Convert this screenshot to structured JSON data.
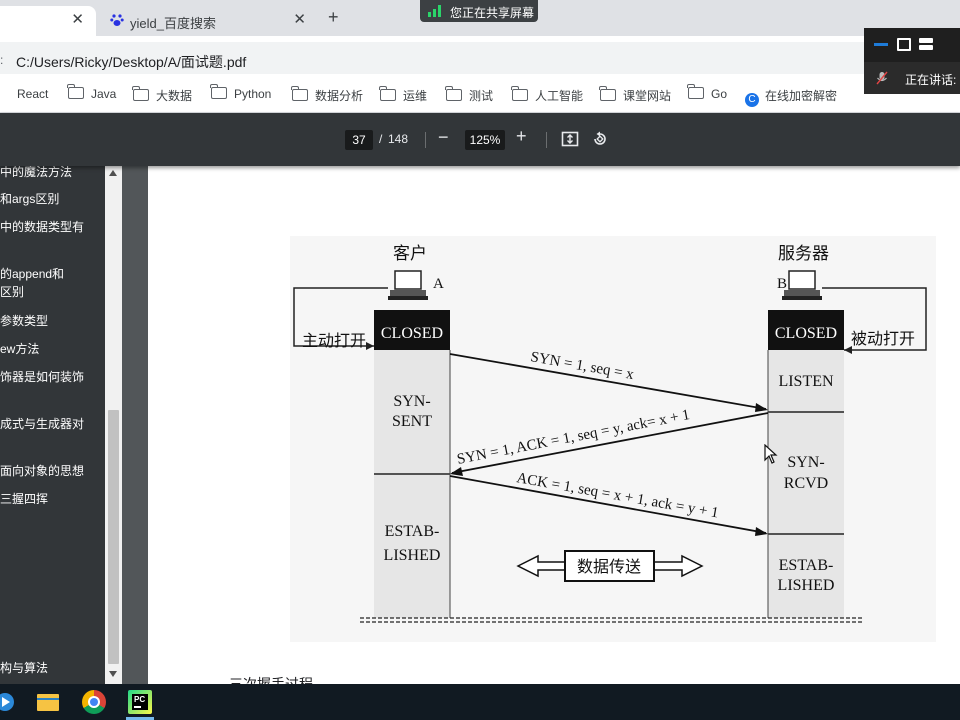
{
  "browser": {
    "tabs": [
      {
        "title": "",
        "active": true
      },
      {
        "title": "yield_百度搜索",
        "active": false
      }
    ],
    "url": "C:/Users/Ricky/Desktop/A/面试题.pdf",
    "bookmarks": [
      "React",
      "Java",
      "大数据",
      "Python",
      "数据分析",
      "运维",
      "测试",
      "人工智能",
      "课堂网站",
      "Go",
      "在线加密解密"
    ]
  },
  "share_banner": "您正在共享屏幕",
  "meeting": {
    "speaking_label": "正在讲话:"
  },
  "pdf": {
    "current_page": "37",
    "separator": "/",
    "total_pages": "148",
    "zoom": "125%",
    "outline": [
      "中的魔法方法",
      "和args区别",
      "中的数据类型有",
      "的append和",
      "区别",
      "参数类型",
      "ew方法",
      "饰器是如何装饰",
      "成式与生成器对",
      "面向对象的思想",
      "三握四挥",
      "构与算法"
    ],
    "caption": "三次握手过程"
  },
  "diagram": {
    "client_label": "客户",
    "server_label": "服务器",
    "client_id": "A",
    "server_id": "B",
    "active_open": "主动打开",
    "passive_open": "被动打开",
    "client_states": [
      "CLOSED",
      "SYN-",
      "SENT",
      "ESTAB-",
      "LISHED"
    ],
    "server_states": [
      "CLOSED",
      "LISTEN",
      "SYN-",
      "RCVD",
      "ESTAB-",
      "LISHED"
    ],
    "messages": [
      "SYN = 1, seq = x",
      "SYN = 1, ACK = 1, seq = y, ack= x + 1",
      "ACK = 1, seq = x + 1, ack = y + 1"
    ],
    "data_transfer": "数据传送"
  },
  "colors": {
    "pdf_toolbar": "#323639",
    "tab_strip": "#dfe1e5",
    "taskbar": "#111a22",
    "state_fill": "#e8e8e8",
    "closed_fill": "#111111"
  }
}
